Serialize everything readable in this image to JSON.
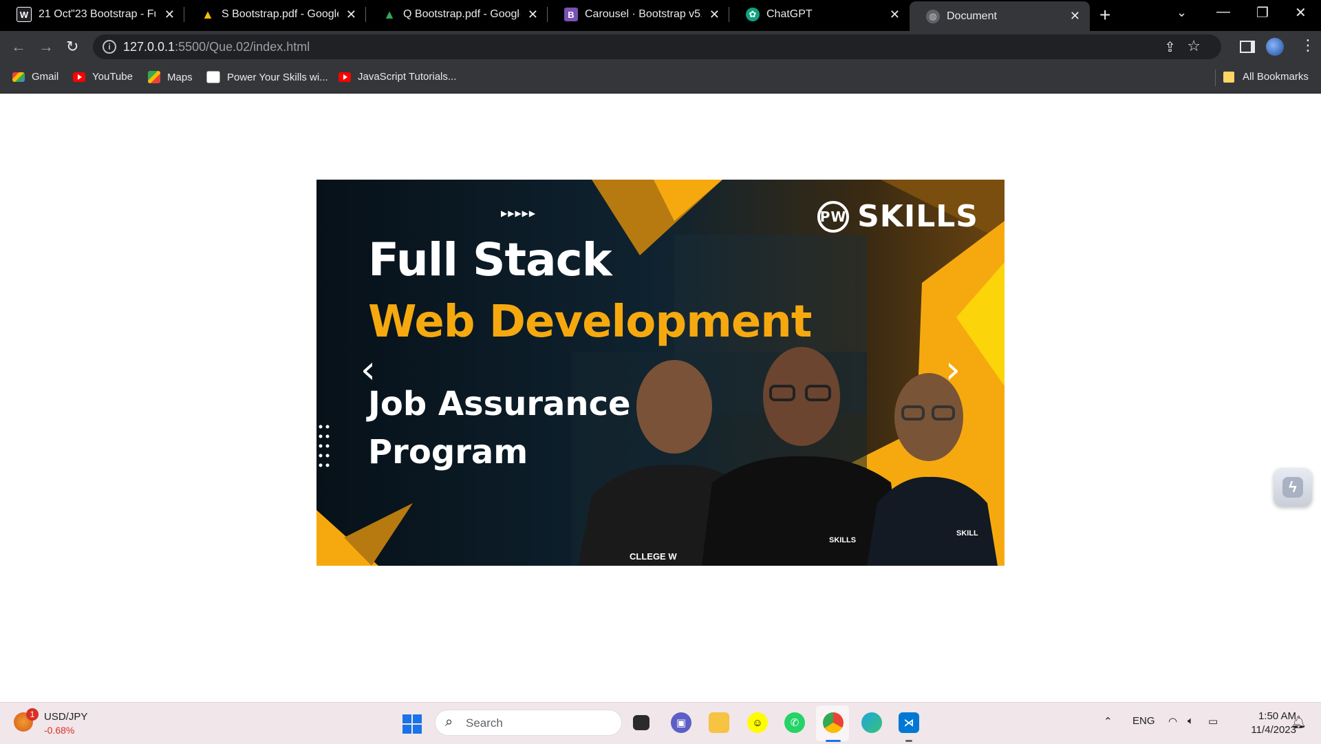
{
  "browser": {
    "tabs": [
      {
        "title": "21 Oct\"23 Bootstrap - Full",
        "icon": "wordpress-icon",
        "fav_color": "#ffffff",
        "fav_bg": "#202124",
        "fav_glyph": "W"
      },
      {
        "title": "S Bootstrap.pdf - Google D",
        "icon": "google-drive-icon",
        "fav_color": "#ffffff",
        "fav_bg": "#1e8e3e",
        "fav_glyph": "▲"
      },
      {
        "title": "Q Bootstrap.pdf - Google D",
        "icon": "google-drive-icon",
        "fav_color": "#ffffff",
        "fav_bg": "#1e8e3e",
        "fav_glyph": "▲"
      },
      {
        "title": "Carousel · Bootstrap v5.3",
        "icon": "bootstrap-icon",
        "fav_color": "#ffffff",
        "fav_bg": "#7952b3",
        "fav_glyph": "B"
      },
      {
        "title": "ChatGPT",
        "icon": "chatgpt-icon",
        "fav_color": "#ffffff",
        "fav_bg": "#10a37f",
        "fav_glyph": "✿"
      },
      {
        "title": "Document",
        "icon": "globe-icon",
        "fav_color": "#bdc1c6",
        "fav_bg": "#5f6368",
        "fav_glyph": "◍",
        "active": true
      }
    ],
    "url_host": "127.0.0.1",
    "url_rest": ":5500/Que.02/index.html",
    "bookmarks": [
      {
        "label": "Gmail",
        "icon": "gmail-icon"
      },
      {
        "label": "YouTube",
        "icon": "youtube-icon"
      },
      {
        "label": "Maps",
        "icon": "maps-icon"
      },
      {
        "label": "Power Your Skills wi...",
        "icon": "pw-icon"
      },
      {
        "label": "JavaScript Tutorials...",
        "icon": "youtube-icon"
      }
    ],
    "all_bookmarks": "All Bookmarks"
  },
  "carousel": {
    "logo_text": "SKILLS",
    "logo_mark": "PW",
    "line1": "Full Stack",
    "line2": "Web Development",
    "line3": "Job Assurance",
    "line4": "Program",
    "arrows_glyph": "▶▶▶▶▶",
    "prev_glyph": "‹",
    "next_glyph": "›",
    "shirt1": "CLLEGE W",
    "shirt2": "SKILLS",
    "shirt3": "SKILL",
    "colors": {
      "accent": "#f6a90f",
      "bg": "#0c1620",
      "yellow": "#fbbd08"
    }
  },
  "taskbar": {
    "ticker_symbol": "USD/JPY",
    "ticker_change": "-0.68%",
    "ticker_badge": "1",
    "search_placeholder": "Search",
    "lang": "ENG",
    "time": "1:50 AM",
    "date": "11/4/2023"
  }
}
